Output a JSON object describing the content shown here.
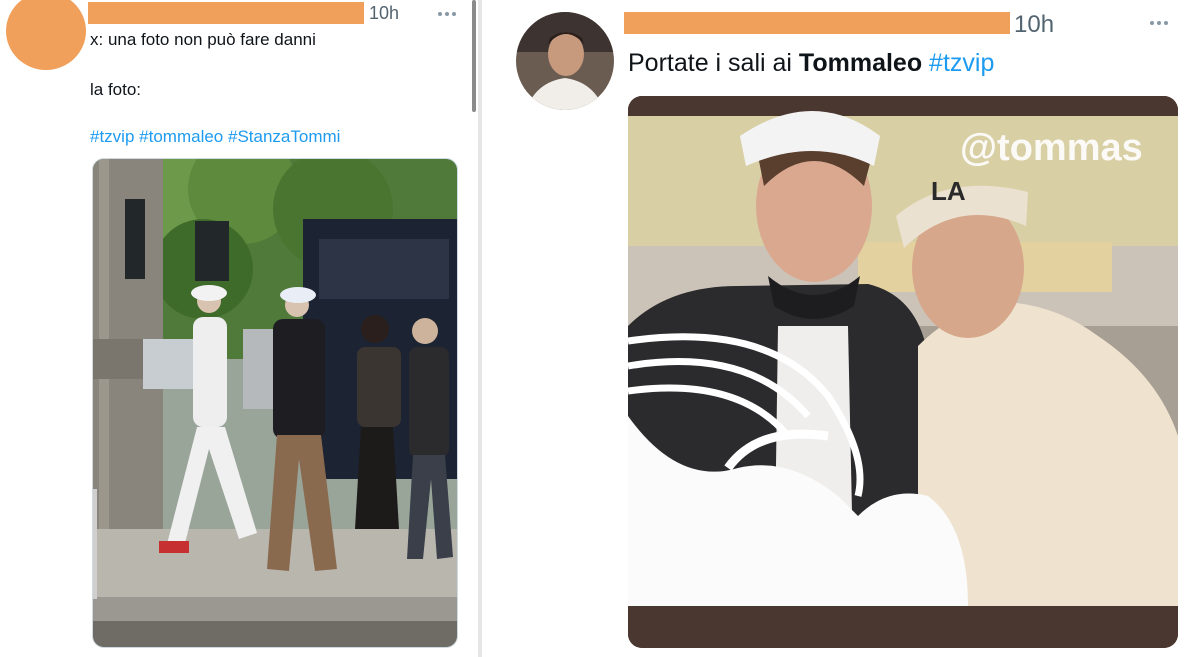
{
  "left_tweet": {
    "time": "10h",
    "line1": "x: una foto non può fare danni",
    "line2": "la foto:",
    "hashtags": [
      "#tzvip",
      "#tommaleo",
      "#StanzaTommi"
    ],
    "more_icon": "more-horizontal-icon"
  },
  "right_tweet": {
    "time": "10h",
    "text_prefix": "Portate i sali ai ",
    "text_bold": "Tommaleo",
    "hashtag": "#tzvip",
    "watermark": "@tommas",
    "more_icon": "more-horizontal-icon"
  },
  "colors": {
    "redaction": "#f0a05a",
    "hashtag": "#1d9bf0",
    "meta": "#536471"
  }
}
